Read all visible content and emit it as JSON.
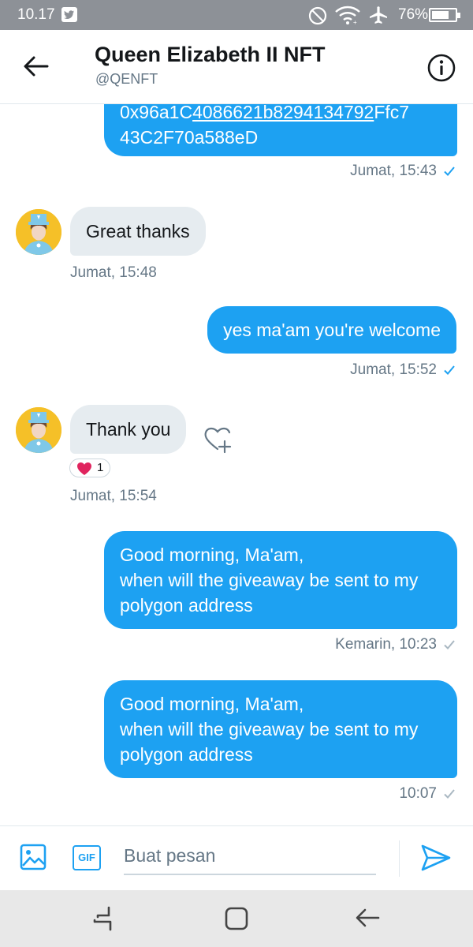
{
  "status_bar": {
    "time": "10.17",
    "battery_percent": "76%",
    "battery_level": 0.76,
    "icons": [
      "twitter-icon",
      "dnd-icon",
      "wifi-icon",
      "airplane-icon",
      "battery-icon"
    ]
  },
  "header": {
    "title": "Queen Elizabeth II NFT",
    "handle": "@QENFT"
  },
  "messages": [
    {
      "direction": "out",
      "address_line1_prefix": "0x96a1C",
      "address_line1_link": "4086621b8294134792",
      "address_line1_suffix": "Ffc7",
      "address_line2": "43C2F70a588eD",
      "time": "Jumat, 15:43",
      "status": "read"
    },
    {
      "direction": "in",
      "text": "Great thanks",
      "time": "Jumat, 15:48"
    },
    {
      "direction": "out",
      "text": "yes ma'am you're welcome",
      "time": "Jumat, 15:52",
      "status": "read"
    },
    {
      "direction": "in",
      "text": "Thank you",
      "time": "Jumat, 15:54",
      "reaction": {
        "emoji": "heart-icon",
        "count": "1"
      }
    },
    {
      "direction": "out",
      "lines": [
        "Good morning, Ma'am,",
        "when will the giveaway be sent to my",
        "polygon address"
      ],
      "time": "Kemarin, 10:23",
      "status": "sent"
    },
    {
      "direction": "out",
      "lines": [
        "Good morning, Ma'am,",
        "when will the giveaway be sent to my",
        "polygon address"
      ],
      "time": "10:07",
      "status": "sent"
    }
  ],
  "composer": {
    "placeholder": "Buat pesan",
    "gif_label": "GIF"
  },
  "colors": {
    "accent": "#1da1f2",
    "bubble_in": "#e6ecf0",
    "status_bar": "#8d9197",
    "heart": "#e0245e"
  }
}
